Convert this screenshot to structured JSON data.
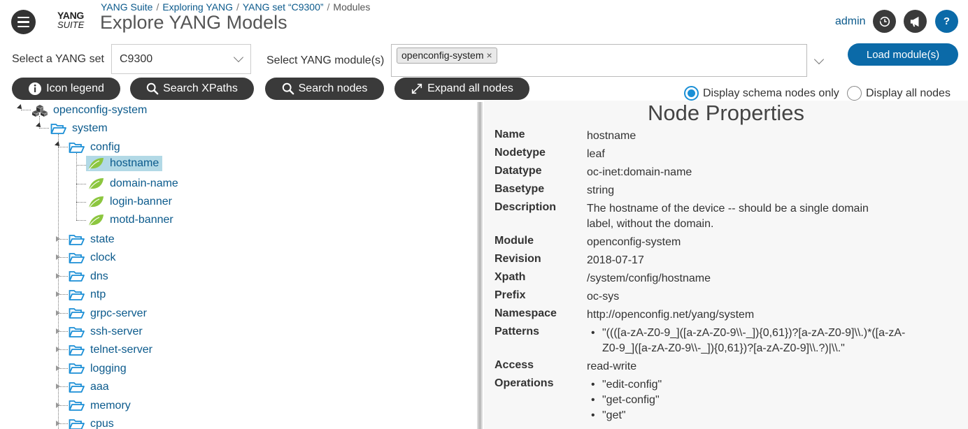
{
  "header": {
    "logo_line1": "YANG",
    "logo_line2": "SUITE",
    "breadcrumb": [
      "YANG Suite",
      "Exploring YANG",
      "YANG set “C9300”",
      "Modules"
    ],
    "title": "Explore YANG Models",
    "user": "admin",
    "help_label": "?"
  },
  "selectors": {
    "yang_set_label": "Select a YANG set",
    "yang_set_value": "C9300",
    "module_label": "Select YANG module(s)",
    "selected_modules": [
      "openconfig-system"
    ],
    "tag_remove": "×",
    "load_button": "Load module(s)"
  },
  "toolbar": {
    "icon_legend": "Icon legend",
    "search_xpaths": "Search XPaths",
    "search_nodes": "Search nodes",
    "expand_all": "Expand all nodes",
    "radio_schema": "Display schema nodes only",
    "radio_all": "Display all nodes",
    "radio_selected": "schema"
  },
  "tree": {
    "root": "openconfig-system",
    "system": "system",
    "config": "config",
    "leaves": [
      "hostname",
      "domain-name",
      "login-banner",
      "motd-banner"
    ],
    "selected_leaf": "hostname",
    "containers": [
      "state",
      "clock",
      "dns",
      "ntp",
      "grpc-server",
      "ssh-server",
      "telnet-server",
      "logging",
      "aaa",
      "memory",
      "cpus"
    ]
  },
  "properties": {
    "title": "Node Properties",
    "name_k": "Name",
    "name_v": "hostname",
    "nodetype_k": "Nodetype",
    "nodetype_v": "leaf",
    "datatype_k": "Datatype",
    "datatype_v": "oc-inet:domain-name",
    "basetype_k": "Basetype",
    "basetype_v": "string",
    "description_k": "Description",
    "description_v1": "The hostname of the device -- should be a single domain",
    "description_v2": "label, without the domain.",
    "module_k": "Module",
    "module_v": "openconfig-system",
    "revision_k": "Revision",
    "revision_v": "2018-07-17",
    "xpath_k": "Xpath",
    "xpath_v": "/system/config/hostname",
    "prefix_k": "Prefix",
    "prefix_v": "oc-sys",
    "namespace_k": "Namespace",
    "namespace_v": "http://openconfig.net/yang/system",
    "patterns_k": "Patterns",
    "patterns_v1": "\"((([a-zA-Z0-9_]([a-zA-Z0-9\\\\-_]){0,61})?[a-zA-Z0-9]\\\\.)*([a-zA-",
    "patterns_v2": "Z0-9_]([a-zA-Z0-9\\\\-_]){0,61})?[a-zA-Z0-9]\\\\.?)|\\\\.\"",
    "access_k": "Access",
    "access_v": "read-write",
    "operations_k": "Operations",
    "operations": [
      "\"edit-config\"",
      "\"get-config\"",
      "\"get\""
    ]
  },
  "colors": {
    "brand_blue": "#0b6aa8",
    "link_blue": "#0b5a8c",
    "pill_dark": "#3a3a3a",
    "leaf_green": "#8cc63f",
    "folder_blue": "#1b8fd6",
    "selection": "#b2d9e6"
  },
  "icons": {
    "menu": "hamburger-icon",
    "history": "history-icon",
    "announce": "megaphone-icon",
    "help": "help-icon",
    "legend": "info-icon",
    "search": "search-icon",
    "expand": "expand-arrows-icon",
    "module": "cubes-icon",
    "container": "folder-open-icon",
    "leaf": "leaf-icon"
  }
}
